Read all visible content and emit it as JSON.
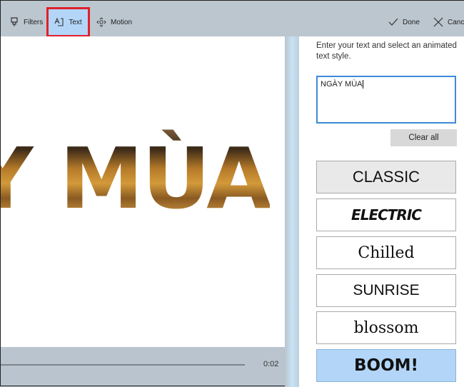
{
  "toolbar": {
    "filters": "Filters",
    "text": "Text",
    "motion": "Motion",
    "done": "Done",
    "cancel": "Cancel"
  },
  "preview": {
    "text": "Y MÙA",
    "time": "0:02"
  },
  "panel": {
    "instruction": "Enter your text and select an animated text style.",
    "input_value": "NGÀY MÙA",
    "clear_all": "Clear all",
    "styles": [
      "CLASSIC",
      "ELECTRIC",
      "Chilled",
      "SUNRISE",
      "blossom",
      "BOOM!"
    ],
    "selected_style": "BOOM!"
  },
  "colors": {
    "accent": "#3c8ad8",
    "selected": "#b3d6f8",
    "highlight": "#e0202a"
  }
}
